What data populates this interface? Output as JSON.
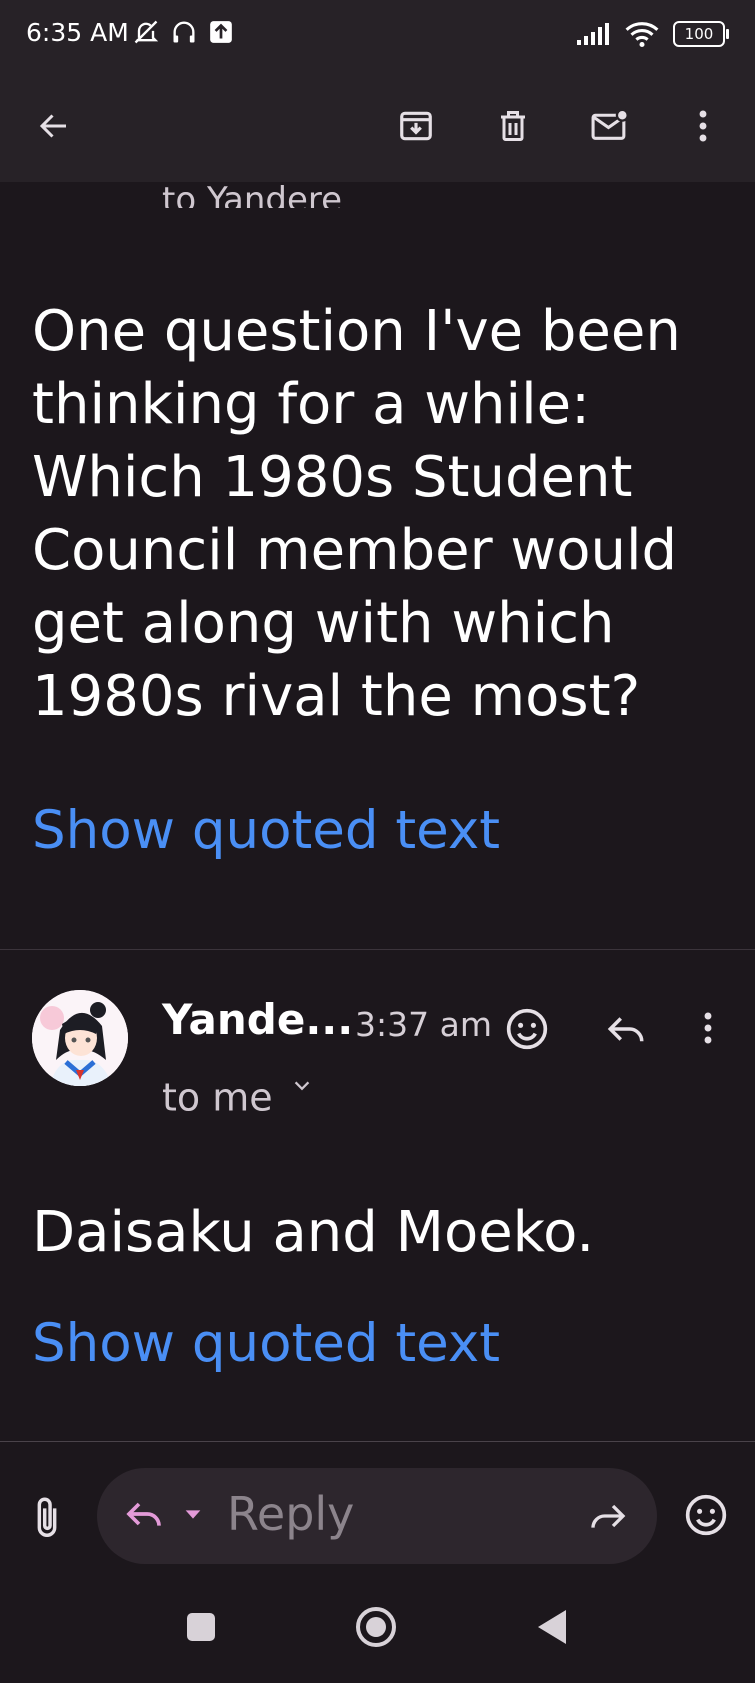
{
  "status_bar": {
    "time": "6:35 AM",
    "battery": "100"
  },
  "thread": {
    "prev_recipient_line": "to Yandere",
    "prev_body": "One question I've been thinking for a while: Which 1980s Student Council member would get along with which 1980s rival the most?",
    "show_quoted_label_1": "Show quoted text",
    "message": {
      "sender": "Yande...",
      "time": "3:37 am",
      "to": "to me",
      "body": "Daisaku and Moeko.",
      "show_quoted_label": "Show quoted text"
    }
  },
  "compose": {
    "placeholder": "Reply"
  },
  "colors": {
    "background": "#1c171c",
    "app_bar": "#272227",
    "link": "#4a8ff5",
    "reply_accent": "#e39ad8"
  }
}
